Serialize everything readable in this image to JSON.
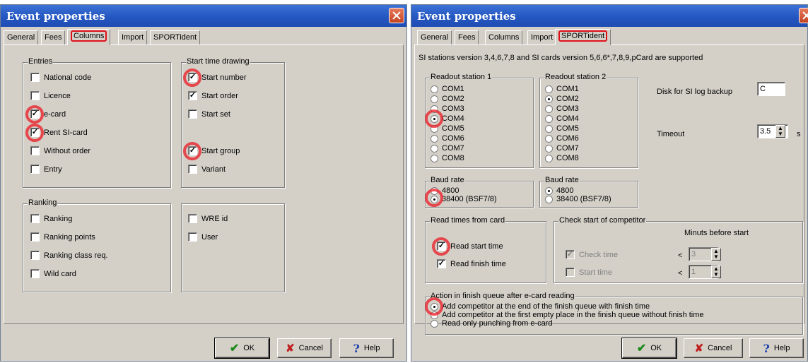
{
  "left": {
    "title": "Event properties",
    "tabs": [
      "General",
      "Fees",
      "Columns",
      "Import",
      "SPORTident"
    ],
    "entries": {
      "legend": "Entries",
      "items": [
        {
          "label": "National code",
          "checked": false
        },
        {
          "label": "Licence",
          "checked": false
        },
        {
          "label": "e-card",
          "checked": true
        },
        {
          "label": "Rent SI-card",
          "checked": true
        },
        {
          "label": "Without order",
          "checked": false
        },
        {
          "label": "Entry",
          "checked": false
        }
      ]
    },
    "start_time": {
      "legend": "Start time drawing",
      "items": [
        {
          "label": "Start number",
          "checked": true
        },
        {
          "label": "Start order",
          "checked": true
        },
        {
          "label": "Start set",
          "checked": false
        },
        {
          "label": "Start group",
          "checked": true
        },
        {
          "label": "Variant",
          "checked": false
        }
      ]
    },
    "ranking": {
      "legend": "Ranking",
      "items": [
        {
          "label": "Ranking",
          "checked": false
        },
        {
          "label": "Ranking points",
          "checked": false
        },
        {
          "label": "Ranking class req.",
          "checked": false
        },
        {
          "label": "Wild card",
          "checked": false
        }
      ]
    },
    "other": {
      "items": [
        {
          "label": "WRE id",
          "checked": false
        },
        {
          "label": "User",
          "checked": false
        }
      ]
    },
    "buttons": {
      "ok": "OK",
      "cancel": "Cancel",
      "help": "Help"
    }
  },
  "right": {
    "title": "Event properties",
    "tabs": [
      "General",
      "Fees",
      "Columns",
      "Import",
      "SPORTident"
    ],
    "info": "SI stations version 3,4,6,7,8 and SI cards version 5,6,6*,7,8,9,pCard are supported",
    "readout1": {
      "legend": "Readout station 1",
      "ports": [
        "COM1",
        "COM2",
        "COM3",
        "COM4",
        "COM5",
        "COM6",
        "COM7",
        "COM8"
      ],
      "selected": "COM4"
    },
    "readout2": {
      "legend": "Readout station 2",
      "ports": [
        "COM1",
        "COM2",
        "COM3",
        "COM4",
        "COM5",
        "COM6",
        "COM7",
        "COM8"
      ],
      "selected": "COM2"
    },
    "disk_label": "Disk for SI log backup",
    "disk_value": "C",
    "timeout_label": "Timeout",
    "timeout_value": "3.5",
    "timeout_unit": "s",
    "baud1": {
      "legend": "Baud rate",
      "options": [
        "4800",
        "38400 (BSF7/8)"
      ],
      "selected": "38400 (BSF7/8)"
    },
    "baud2": {
      "legend": "Baud rate",
      "options": [
        "4800",
        "38400 (BSF7/8)"
      ],
      "selected": "4800"
    },
    "read_times": {
      "legend": "Read times from card",
      "items": [
        {
          "label": "Read start time",
          "checked": true
        },
        {
          "label": "Read finish time",
          "checked": true
        }
      ]
    },
    "check_start": {
      "legend": "Check start of competitor",
      "header": "Minuts before start",
      "items": [
        {
          "label": "Check time",
          "checked": true,
          "value": "3"
        },
        {
          "label": "Start time",
          "checked": false,
          "value": "1"
        }
      ],
      "lt": "<"
    },
    "finish_queue": {
      "legend": "Action in finish queue after e-card reading",
      "options": [
        "Add competitor at the end of the finish queue with finish time",
        "Add competitor at the first empty place in the finish queue without finish time",
        "Read only punching from e-card"
      ],
      "selected_index": 0
    },
    "buttons": {
      "ok": "OK",
      "cancel": "Cancel",
      "help": "Help"
    }
  }
}
